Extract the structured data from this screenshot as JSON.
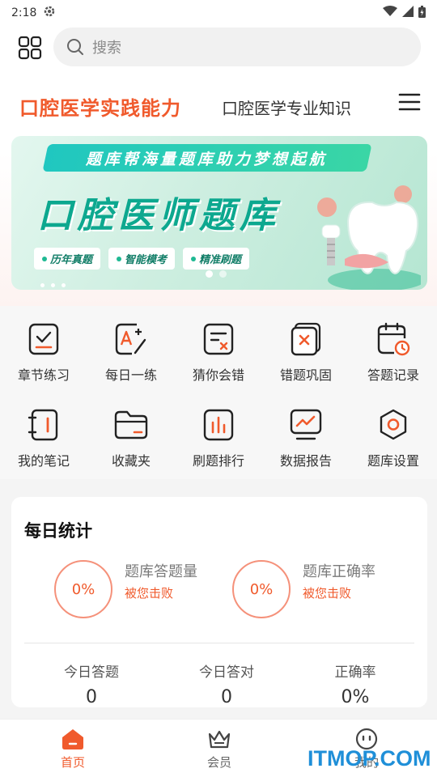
{
  "status_bar": {
    "time": "2:18"
  },
  "search": {
    "placeholder": "搜索",
    "icon": "search-icon"
  },
  "categories": {
    "active": "口腔医学实践能力",
    "other": "口腔医学专业知识"
  },
  "banner": {
    "ribbon": "题库帮海量题库助力梦想起航",
    "headline": "口腔医师题库",
    "tags": [
      "历年真题",
      "智能模考",
      "精准刷题"
    ]
  },
  "features": [
    {
      "label": "章节练习",
      "icon": "chapter-practice-icon"
    },
    {
      "label": "每日一练",
      "icon": "daily-practice-icon"
    },
    {
      "label": "猜你会错",
      "icon": "guess-wrong-icon"
    },
    {
      "label": "错题巩固",
      "icon": "wrong-review-icon"
    },
    {
      "label": "答题记录",
      "icon": "answer-record-icon"
    },
    {
      "label": "我的笔记",
      "icon": "notes-icon"
    },
    {
      "label": "收藏夹",
      "icon": "favorites-folder-icon"
    },
    {
      "label": "刷题排行",
      "icon": "ranking-icon"
    },
    {
      "label": "数据报告",
      "icon": "data-report-icon"
    },
    {
      "label": "题库设置",
      "icon": "settings-icon"
    }
  ],
  "daily_stats": {
    "title": "每日统计",
    "answer_count": {
      "percent": "0%",
      "name": "题库答题量",
      "sub": "被您击败"
    },
    "accuracy": {
      "percent": "0%",
      "name": "题库正确率",
      "sub": "被您击败"
    },
    "today": [
      {
        "key": "今日答题",
        "value": "0"
      },
      {
        "key": "今日答对",
        "value": "0"
      },
      {
        "key": "正确率",
        "value": "0%"
      }
    ]
  },
  "tabbar": {
    "tabs": [
      {
        "label": "首页",
        "icon": "home-icon",
        "active": true
      },
      {
        "label": "会员",
        "icon": "crown-icon",
        "active": false
      },
      {
        "label": "我的",
        "icon": "profile-face-icon",
        "active": false
      }
    ]
  },
  "watermark": "ITMOP.COM",
  "colors": {
    "accent": "#f05a2c",
    "banner_green": "#0da88f"
  }
}
